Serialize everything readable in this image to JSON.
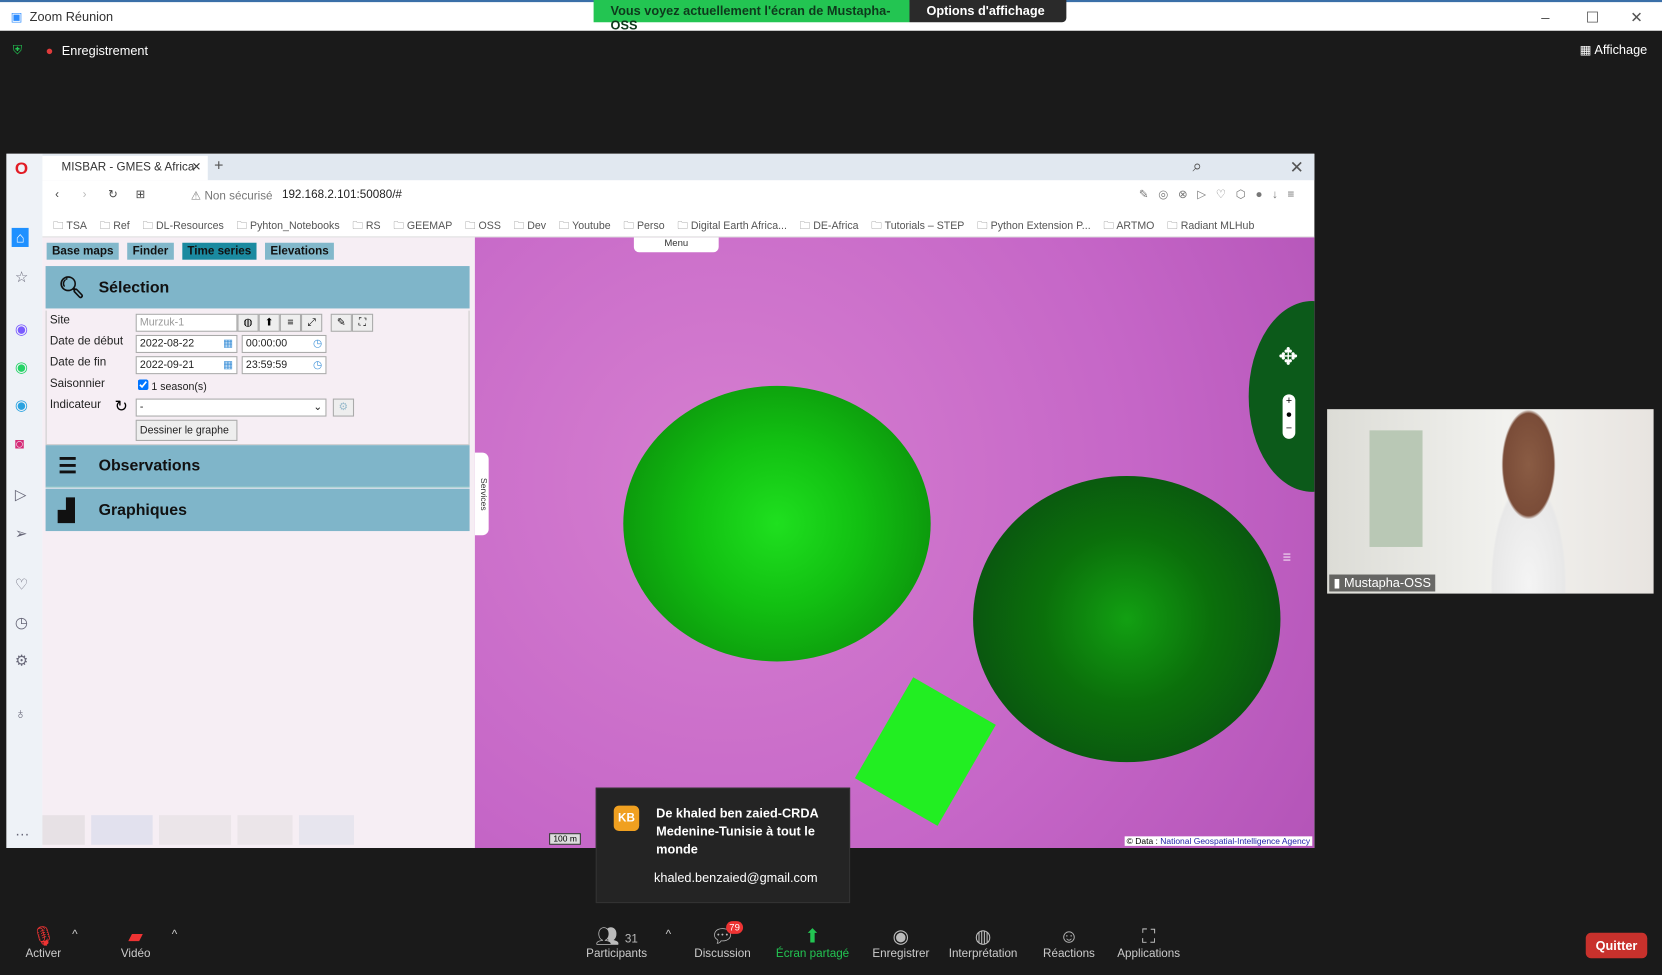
{
  "zoom": {
    "title": "Zoom Réunion",
    "banner": "Vous voyez actuellement l'écran de Mustapha-OSS",
    "options": "Options d'affichage",
    "recording": "Enregistrement",
    "view": "Affichage"
  },
  "browser": {
    "tab_title": "MISBAR - GMES & Africa",
    "security": "Non sécurisé",
    "url": "192.168.2.101:50080/#",
    "bookmarks": [
      "TSA",
      "Ref",
      "DL-Resources",
      "Pyhton_Notebooks",
      "RS",
      "GEEMAP",
      "OSS",
      "Dev",
      "Youtube",
      "Perso",
      "Digital Earth Africa...",
      "DE-Africa",
      "Tutorials – STEP",
      "Python Extension P...",
      "ARTMO",
      "Radiant MLHub"
    ]
  },
  "app": {
    "tabs": [
      "Base maps",
      "Finder",
      "Time series",
      "Elevations"
    ],
    "active_tab": "Time series",
    "selection": {
      "title": "Sélection",
      "site_label": "Site",
      "site_value": "Murzuk-1",
      "start_label": "Date de début",
      "start_date": "2022-08-22",
      "start_time": "00:00:00",
      "end_label": "Date de fin",
      "end_date": "2022-09-21",
      "end_time": "23:59:59",
      "season_label": "Saisonnier",
      "season_value": "1 season(s)",
      "season_checked": true,
      "indicator_label": "Indicateur",
      "indicator_value": "-",
      "draw_button": "Dessiner le graphe"
    },
    "observations": "Observations",
    "graphs": "Graphiques",
    "services": "Services",
    "menu": "Menu",
    "scale": "100 m",
    "attribution_prefix": "© Data :",
    "attribution_link": "National Geospatial-Intelligence Agency"
  },
  "video": {
    "name": "Mustapha-OSS"
  },
  "toast": {
    "initials": "KB",
    "title": "De khaled ben zaied-CRDA Medenine-Tunisie à tout le monde",
    "message": "khaled.benzaied@gmail.com"
  },
  "toolbar": {
    "mute": "Activer",
    "video": "Vidéo",
    "participants": "Participants",
    "participants_count": "31",
    "chat": "Discussion",
    "chat_badge": "79",
    "share": "Écran partagé",
    "record": "Enregistrer",
    "interpretation": "Interprétation",
    "reactions": "Réactions",
    "apps": "Applications",
    "quit": "Quitter"
  }
}
